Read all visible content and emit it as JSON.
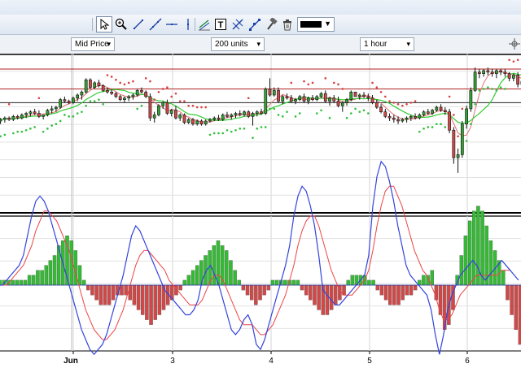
{
  "toolbar": {
    "tools": [
      {
        "name": "pointer-icon",
        "selected": true
      },
      {
        "name": "zoom-icon",
        "selected": false
      },
      {
        "name": "line-icon",
        "selected": false
      },
      {
        "name": "ray-icon",
        "selected": false
      },
      {
        "name": "horizontal-line-icon",
        "selected": false
      },
      {
        "name": "vertical-line-icon",
        "selected": false
      },
      {
        "name": "trend-channel-icon",
        "selected": false
      },
      {
        "name": "text-tool-icon",
        "selected": false
      },
      {
        "name": "fibonacci-icon",
        "selected": false
      },
      {
        "name": "multi-line-icon",
        "selected": false
      },
      {
        "name": "hammer-icon",
        "selected": false
      },
      {
        "name": "trash-icon",
        "selected": false
      }
    ],
    "line_color": "#000000"
  },
  "selectors": {
    "price": "Mid Price",
    "units": "200 units",
    "timeframe": "1 hour"
  },
  "x_axis_labels": [
    "Jun",
    "3",
    "4",
    "5",
    "6"
  ],
  "colors": {
    "candle_up": "#33a133",
    "candle_down": "#d04848",
    "sar": "#2fbf3a",
    "sar_down": "#d84040",
    "ma": "#33cc33",
    "ma2": "#e07070",
    "hist_up": "#33bb33",
    "hist_down": "#d04848",
    "macd": "#3344dd",
    "signal": "#ee4444",
    "horizontal_line": "#b02020"
  },
  "chart_data": [
    {
      "type": "candlestick",
      "ylim": [
        0,
        100
      ],
      "grid": true,
      "horizontal_lines": [
        92,
        79,
        70
      ],
      "candles": [
        [
          58,
          60,
          56,
          59
        ],
        [
          59,
          61,
          57,
          60
        ],
        [
          60,
          61,
          58,
          59
        ],
        [
          59,
          62,
          58,
          61
        ],
        [
          61,
          62,
          59,
          60
        ],
        [
          60,
          63,
          59,
          62
        ],
        [
          62,
          64,
          60,
          63
        ],
        [
          63,
          65,
          61,
          64
        ],
        [
          64,
          66,
          62,
          63
        ],
        [
          63,
          65,
          60,
          61
        ],
        [
          61,
          62,
          59,
          62
        ],
        [
          62,
          66,
          61,
          65
        ],
        [
          65,
          68,
          63,
          66
        ],
        [
          66,
          68,
          64,
          67
        ],
        [
          67,
          73,
          66,
          72
        ],
        [
          72,
          74,
          70,
          71
        ],
        [
          71,
          72,
          69,
          70
        ],
        [
          70,
          74,
          69,
          73
        ],
        [
          73,
          76,
          71,
          75
        ],
        [
          75,
          78,
          72,
          77
        ],
        [
          77,
          86,
          76,
          85
        ],
        [
          85,
          86,
          79,
          80
        ],
        [
          80,
          84,
          79,
          83
        ],
        [
          83,
          85,
          80,
          81
        ],
        [
          81,
          82,
          77,
          78
        ],
        [
          78,
          80,
          76,
          77
        ],
        [
          77,
          79,
          75,
          76
        ],
        [
          76,
          77,
          73,
          74
        ],
        [
          74,
          75,
          71,
          72
        ],
        [
          72,
          74,
          70,
          73
        ],
        [
          73,
          75,
          71,
          74
        ],
        [
          74,
          76,
          72,
          75
        ],
        [
          75,
          79,
          74,
          78
        ],
        [
          78,
          80,
          76,
          77
        ],
        [
          77,
          78,
          73,
          74
        ],
        [
          74,
          76,
          58,
          60
        ],
        [
          60,
          64,
          57,
          62
        ],
        [
          62,
          69,
          61,
          68
        ],
        [
          68,
          71,
          66,
          70
        ],
        [
          70,
          72,
          62,
          63
        ],
        [
          63,
          66,
          61,
          65
        ],
        [
          65,
          68,
          59,
          60
        ],
        [
          60,
          63,
          58,
          62
        ],
        [
          62,
          63,
          56,
          57
        ],
        [
          57,
          60,
          56,
          59
        ],
        [
          59,
          60,
          55,
          56
        ],
        [
          56,
          59,
          55,
          58
        ],
        [
          58,
          59,
          55,
          56
        ],
        [
          56,
          59,
          55,
          58
        ],
        [
          58,
          60,
          57,
          59
        ],
        [
          59,
          61,
          58,
          60
        ],
        [
          60,
          62,
          58,
          59
        ],
        [
          59,
          63,
          58,
          62
        ],
        [
          62,
          64,
          60,
          61
        ],
        [
          61,
          63,
          59,
          62
        ],
        [
          62,
          64,
          60,
          63
        ],
        [
          63,
          65,
          61,
          62
        ],
        [
          62,
          65,
          61,
          64
        ],
        [
          64,
          65,
          60,
          61
        ],
        [
          61,
          64,
          55,
          63
        ],
        [
          63,
          65,
          61,
          64
        ],
        [
          64,
          66,
          62,
          63
        ],
        [
          63,
          80,
          62,
          79
        ],
        [
          79,
          86,
          74,
          75
        ],
        [
          75,
          80,
          74,
          78
        ],
        [
          78,
          80,
          70,
          71
        ],
        [
          71,
          75,
          69,
          74
        ],
        [
          74,
          76,
          72,
          73
        ],
        [
          73,
          75,
          70,
          71
        ],
        [
          71,
          73,
          69,
          72
        ],
        [
          72,
          75,
          71,
          74
        ],
        [
          74,
          76,
          70,
          71
        ],
        [
          71,
          74,
          69,
          73
        ],
        [
          73,
          75,
          71,
          72
        ],
        [
          72,
          75,
          71,
          74
        ],
        [
          74,
          77,
          73,
          76
        ],
        [
          76,
          78,
          70,
          71
        ],
        [
          71,
          74,
          68,
          73
        ],
        [
          73,
          75,
          70,
          71
        ],
        [
          71,
          74,
          67,
          68
        ],
        [
          68,
          71,
          64,
          70
        ],
        [
          70,
          73,
          68,
          72
        ],
        [
          72,
          78,
          71,
          77
        ],
        [
          77,
          76,
          74,
          74
        ],
        [
          74,
          76,
          72,
          75
        ],
        [
          75,
          77,
          73,
          74
        ],
        [
          74,
          76,
          71,
          73
        ],
        [
          73,
          75,
          69,
          70
        ],
        [
          70,
          72,
          66,
          67
        ],
        [
          67,
          69,
          63,
          64
        ],
        [
          64,
          66,
          60,
          61
        ],
        [
          61,
          63,
          58,
          60
        ],
        [
          60,
          62,
          57,
          59
        ],
        [
          59,
          61,
          56,
          58
        ],
        [
          58,
          60,
          57,
          59
        ],
        [
          59,
          61,
          57,
          60
        ],
        [
          60,
          62,
          58,
          61
        ],
        [
          61,
          63,
          59,
          60
        ],
        [
          60,
          63,
          59,
          62
        ],
        [
          62,
          65,
          61,
          64
        ],
        [
          64,
          66,
          62,
          63
        ],
        [
          63,
          66,
          62,
          65
        ],
        [
          65,
          68,
          64,
          67
        ],
        [
          67,
          69,
          64,
          65
        ],
        [
          65,
          67,
          62,
          64
        ],
        [
          64,
          66,
          50,
          52
        ],
        [
          52,
          54,
          30,
          34
        ],
        [
          34,
          40,
          24,
          36
        ],
        [
          36,
          58,
          34,
          56
        ],
        [
          56,
          68,
          53,
          66
        ],
        [
          66,
          80,
          64,
          78
        ],
        [
          78,
          93,
          77,
          90
        ],
        [
          90,
          92,
          86,
          89
        ],
        [
          89,
          92,
          87,
          91
        ],
        [
          91,
          93,
          88,
          90
        ],
        [
          90,
          92,
          87,
          89
        ],
        [
          89,
          92,
          86,
          91
        ],
        [
          91,
          92,
          88,
          90
        ],
        [
          90,
          92,
          87,
          89
        ],
        [
          89,
          90,
          84,
          86
        ],
        [
          86,
          89,
          84,
          88
        ],
        [
          88,
          90,
          80,
          82
        ],
        [
          82,
          86,
          78,
          84
        ]
      ]
    },
    {
      "type": "bar",
      "series": [
        {
          "values": [
            1,
            1,
            1,
            1,
            1,
            1,
            1,
            2,
            2,
            3,
            3,
            4,
            5,
            6,
            8,
            9,
            10,
            9,
            7,
            4,
            1,
            -1,
            -2,
            -3,
            -4,
            -4,
            -4,
            -3,
            -2,
            -2,
            -2,
            -3,
            -4,
            -5,
            -6,
            -7,
            -8,
            -7,
            -6,
            -5,
            -4,
            -3,
            -2,
            -1,
            1,
            2,
            3,
            4,
            5,
            6,
            7,
            8,
            9,
            8,
            7,
            5,
            3,
            1,
            -1,
            -2,
            -3,
            -4,
            -3,
            -2,
            -1,
            1,
            1,
            1,
            1,
            1,
            1,
            1,
            -1,
            -2,
            -3,
            -4,
            -5,
            -6,
            -6,
            -5,
            -4,
            -3,
            -2,
            1,
            2,
            2,
            2,
            2,
            1,
            1,
            -1,
            -2,
            -3,
            -4,
            -4,
            -4,
            -3,
            -2,
            -2,
            -1,
            1,
            2,
            2,
            3,
            -3,
            -6,
            -9,
            -8,
            -5,
            2,
            6,
            10,
            13,
            15,
            16,
            15,
            12,
            9,
            7,
            5,
            3,
            -3,
            -6,
            -9,
            -12
          ]
        }
      ]
    },
    {
      "type": "line",
      "series": [
        {
          "values": [
            0,
            0,
            1,
            2,
            3,
            4,
            6,
            10,
            14,
            17,
            18,
            17,
            15,
            12,
            9,
            6,
            3,
            0,
            -3,
            -6,
            -9,
            -11,
            -13,
            -14,
            -13,
            -12,
            -10,
            -7,
            -4,
            -1,
            2,
            6,
            10,
            12,
            11,
            9,
            7,
            5,
            3,
            1,
            -1,
            -2,
            -3,
            -4,
            -5,
            -6,
            -6,
            -5,
            -3,
            1,
            3,
            4,
            2,
            0,
            -3,
            -6,
            -9,
            -10,
            -9,
            -7,
            -6,
            -8,
            -12,
            -13,
            -11,
            -8,
            -5,
            -2,
            1,
            4,
            8,
            14,
            18,
            20,
            19,
            16,
            12,
            6,
            -1,
            -2,
            -3,
            -4,
            -4,
            -3,
            -2,
            -1,
            0,
            1,
            2,
            6,
            16,
            22,
            25,
            24,
            21,
            17,
            12,
            8,
            4,
            2,
            1,
            0,
            -1,
            -2,
            -5,
            -10,
            -14,
            -10,
            -5,
            -2,
            0,
            2,
            3,
            4,
            5,
            4,
            2,
            1,
            2,
            3,
            4,
            5,
            4,
            3,
            2,
            1
          ]
        },
        {
          "values": [
            0,
            0,
            0,
            1,
            2,
            3,
            4,
            6,
            8,
            11,
            13,
            15,
            15,
            14,
            13,
            11,
            9,
            7,
            4,
            1,
            -2,
            -5,
            -7,
            -9,
            -10,
            -11,
            -11,
            -10,
            -9,
            -7,
            -5,
            -2,
            1,
            4,
            6,
            7,
            7,
            6,
            5,
            4,
            3,
            1,
            0,
            -1,
            -2,
            -3,
            -4,
            -4,
            -4,
            -3,
            -1,
            1,
            2,
            2,
            1,
            -1,
            -3,
            -5,
            -7,
            -8,
            -8,
            -8,
            -9,
            -10,
            -10,
            -9,
            -8,
            -6,
            -4,
            -2,
            1,
            4,
            8,
            11,
            13,
            14,
            14,
            12,
            9,
            6,
            3,
            1,
            -1,
            -2,
            -2,
            -2,
            -1,
            0,
            1,
            3,
            7,
            12,
            16,
            19,
            20,
            20,
            18,
            16,
            13,
            10,
            7,
            5,
            3,
            2,
            0,
            -2,
            -5,
            -7,
            -7,
            -6,
            -4,
            -2,
            -1,
            0,
            1,
            2,
            2,
            2,
            2,
            2,
            2,
            3,
            3,
            3
          ]
        }
      ]
    }
  ]
}
